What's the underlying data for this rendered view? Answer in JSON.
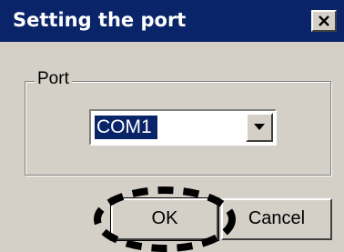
{
  "window": {
    "title": "Setting the port",
    "close_icon": "close-icon"
  },
  "port_group": {
    "label": "Port",
    "selected_value": "COM1",
    "dropdown_icon": "chevron-down-icon"
  },
  "buttons": {
    "ok_label": "OK",
    "cancel_label": "Cancel"
  },
  "annotation": {
    "highlight_icon": "dashed-oval-highlight",
    "highlight_color": "#000000"
  },
  "colors": {
    "titlebar": "#0a246a",
    "face": "#d4d0c8",
    "selection": "#0a246a"
  }
}
